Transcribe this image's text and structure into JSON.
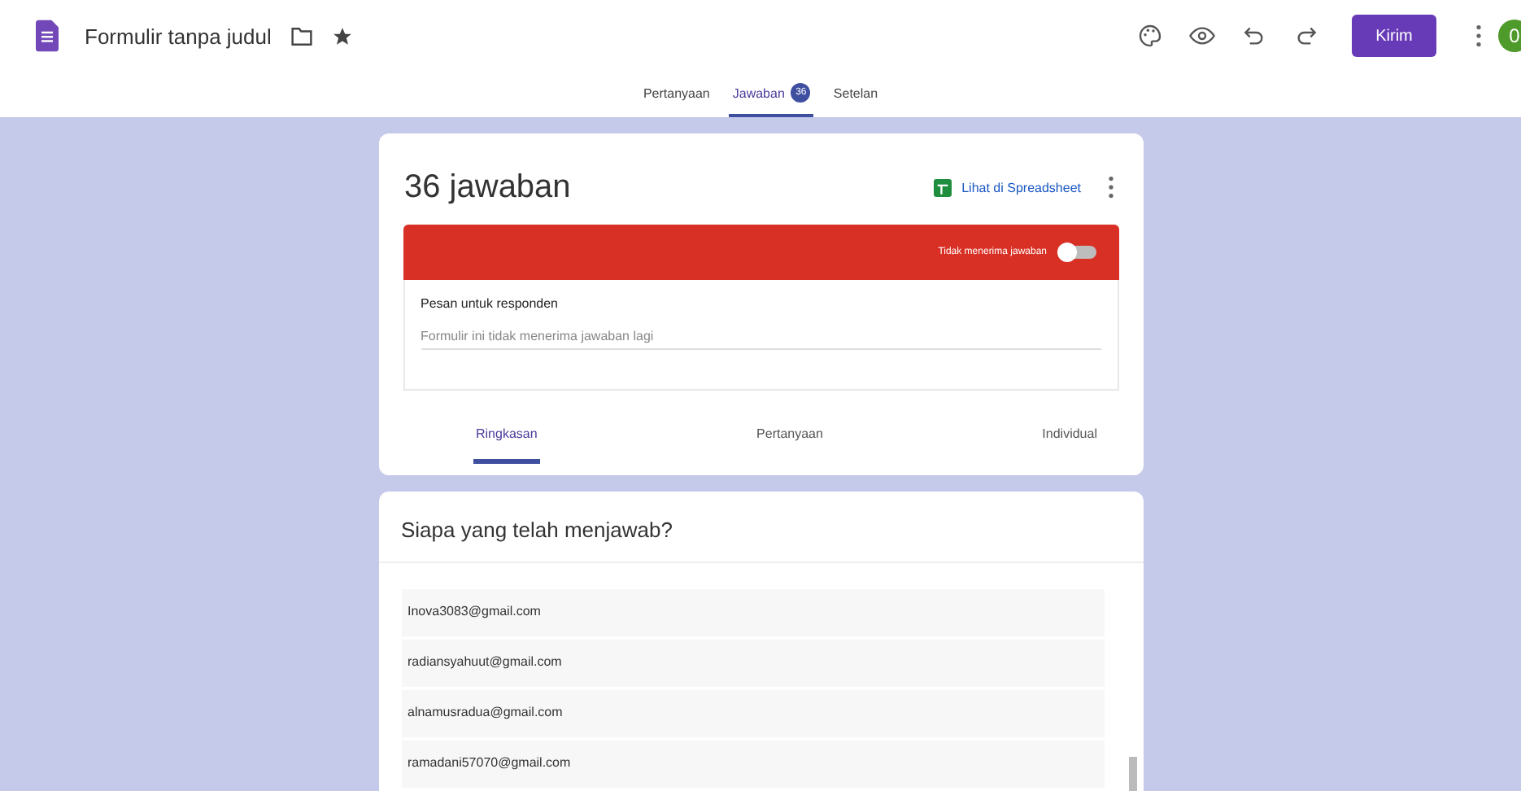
{
  "header": {
    "title": "Formulir tanpa judul",
    "send_button": "Kirim",
    "avatar": "0"
  },
  "tabs": [
    {
      "label": "Pertanyaan",
      "selected": false
    },
    {
      "label": "Jawaban",
      "selected": true,
      "badge": "36"
    },
    {
      "label": "Setelan",
      "selected": false
    }
  ],
  "responses": {
    "count_title": "36 jawaban",
    "sheet_link": "Lihat di Spreadsheet",
    "accepting_label": "Tidak menerima jawaban",
    "accepting": false,
    "message_label": "Pesan untuk responden",
    "message_value": "Formulir ini tidak menerima jawaban lagi",
    "subtabs": [
      {
        "label": "Ringkasan",
        "selected": true
      },
      {
        "label": "Pertanyaan",
        "selected": false
      },
      {
        "label": "Individual",
        "selected": false
      }
    ]
  },
  "who": {
    "title": "Siapa yang telah menjawab?",
    "emails": [
      "Inova3083@gmail.com",
      "radiansyahuut@gmail.com",
      "alnamusradua@gmail.com",
      "ramadani57070@gmail.com"
    ]
  }
}
